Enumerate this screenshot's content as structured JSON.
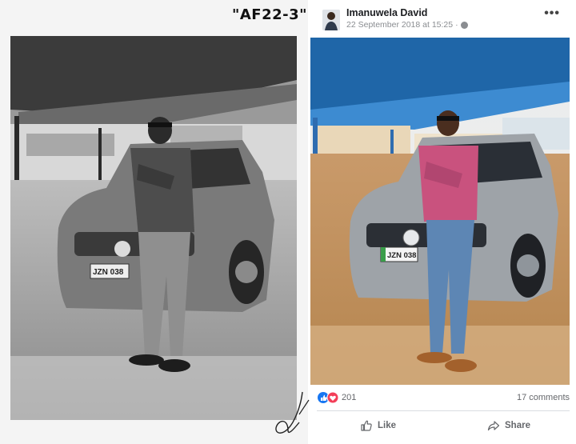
{
  "document": {
    "label": "\"AF22-3\"",
    "plate_text": "JZN 038"
  },
  "post": {
    "author": "Imanuwela David",
    "timestamp": "22 September 2018 at 15:25",
    "more_label": "•••",
    "plate_text": "JZN 038",
    "reaction_count": "201",
    "comments_label": "17 comments",
    "like_label": "Like",
    "share_label": "Share",
    "colors": {
      "like_blue": "#1877f2",
      "love_red": "#f33e58",
      "text_grey": "#65676b"
    }
  }
}
